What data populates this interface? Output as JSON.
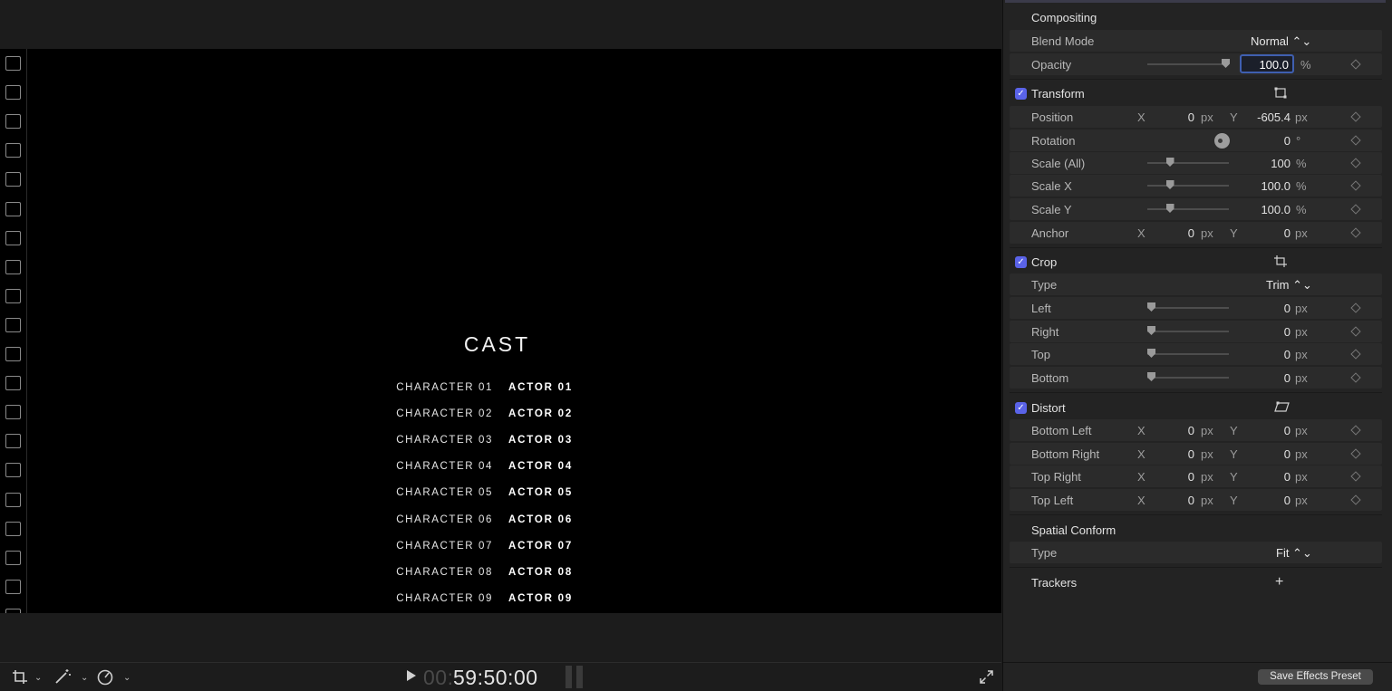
{
  "viewer": {
    "cast_title": "CAST",
    "credits": [
      {
        "character": "CHARACTER 01",
        "actor": "ACTOR 01"
      },
      {
        "character": "CHARACTER 02",
        "actor": "ACTOR 02"
      },
      {
        "character": "CHARACTER 03",
        "actor": "ACTOR 03"
      },
      {
        "character": "CHARACTER 04",
        "actor": "ACTOR 04"
      },
      {
        "character": "CHARACTER 05",
        "actor": "ACTOR 05"
      },
      {
        "character": "CHARACTER 06",
        "actor": "ACTOR 06"
      },
      {
        "character": "CHARACTER 07",
        "actor": "ACTOR 07"
      },
      {
        "character": "CHARACTER 08",
        "actor": "ACTOR 08"
      },
      {
        "character": "CHARACTER 09",
        "actor": "ACTOR 09"
      }
    ],
    "timecode_prefix": "00:",
    "timecode": "59:50:00",
    "icons": [
      "transform-tool-icon",
      "chevron-down-icon",
      "magic-wand-icon",
      "speed-icon",
      "play-icon",
      "fullscreen-icon"
    ]
  },
  "inspector": {
    "compositing": {
      "title": "Compositing",
      "blend_mode_label": "Blend Mode",
      "blend_mode_value": "Normal ⌃⌄",
      "opacity_label": "Opacity",
      "opacity_value": "100.0",
      "opacity_unit": "%",
      "opacity_level": 1.0
    },
    "transform": {
      "title": "Transform",
      "enabled": true,
      "position_label": "Position",
      "position_x": "0",
      "position_y": "-605.4",
      "rotation_label": "Rotation",
      "rotation_value": "0",
      "rotation_unit": "°",
      "scale_all_label": "Scale (All)",
      "scale_all_value": "100",
      "scale_x_label": "Scale X",
      "scale_x_value": "100.0",
      "scale_y_label": "Scale Y",
      "scale_y_value": "100.0",
      "anchor_label": "Anchor",
      "anchor_x": "0",
      "anchor_y": "0",
      "scale_level": 0.25
    },
    "crop": {
      "title": "Crop",
      "enabled": true,
      "type_label": "Type",
      "type_value": "Trim ⌃⌄",
      "left_label": "Left",
      "right_label": "Right",
      "top_label": "Top",
      "bottom_label": "Bottom",
      "left_value": "0",
      "right_value": "0",
      "top_value": "0",
      "bottom_value": "0",
      "slider_level": 0.0
    },
    "distort": {
      "title": "Distort",
      "enabled": true,
      "bottom_left_label": "Bottom Left",
      "bottom_right_label": "Bottom Right",
      "top_right_label": "Top Right",
      "top_left_label": "Top Left",
      "bl_x": "0",
      "bl_y": "0",
      "br_x": "0",
      "br_y": "0",
      "tr_x": "0",
      "tr_y": "0",
      "tl_x": "0",
      "tl_y": "0"
    },
    "spatial_conform": {
      "title": "Spatial Conform",
      "type_label": "Type",
      "type_value": "Fit ⌃⌄"
    },
    "trackers": {
      "title": "Trackers",
      "add_label": "+"
    },
    "labels": {
      "x": "X",
      "y": "Y",
      "px": "px",
      "pct": "%"
    },
    "save_preset_label": "Save Effects Preset"
  }
}
